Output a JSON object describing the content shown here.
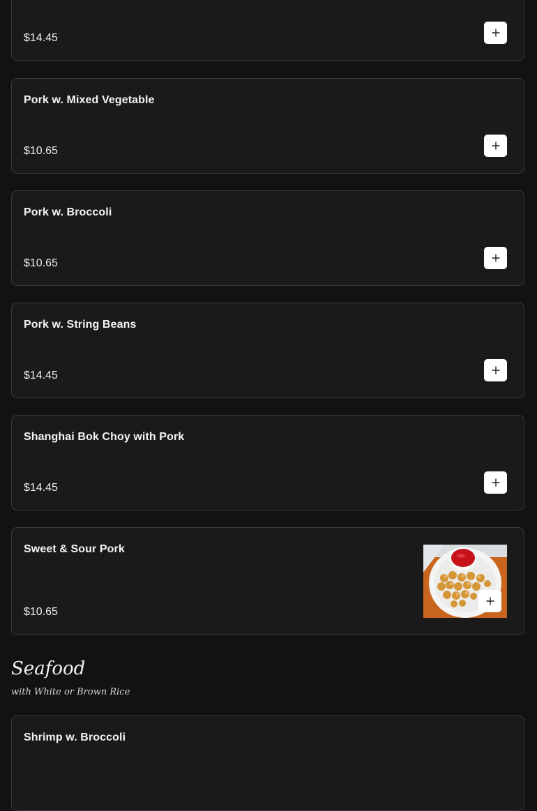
{
  "items": [
    {
      "name": "",
      "price": "$14.45"
    },
    {
      "name": "Pork w. Mixed Vegetable",
      "price": "$10.65"
    },
    {
      "name": "Pork w. Broccoli",
      "price": "$10.65"
    },
    {
      "name": "Pork w. String Beans",
      "price": "$14.45"
    },
    {
      "name": "Shanghai Bok Choy with Pork",
      "price": "$14.45"
    },
    {
      "name": "Sweet & Sour Pork",
      "price": "$10.65"
    },
    {
      "name": "Shrimp w. Broccoli",
      "price": ""
    }
  ],
  "section": {
    "title": "Seafood",
    "subtitle": "with White or Brown Rice"
  },
  "icons": {
    "add": "plus-icon"
  },
  "colors": {
    "background": "#121212",
    "card": "#1a1a1a",
    "card_border": "#3a3a3a",
    "button": "#ffffff"
  }
}
